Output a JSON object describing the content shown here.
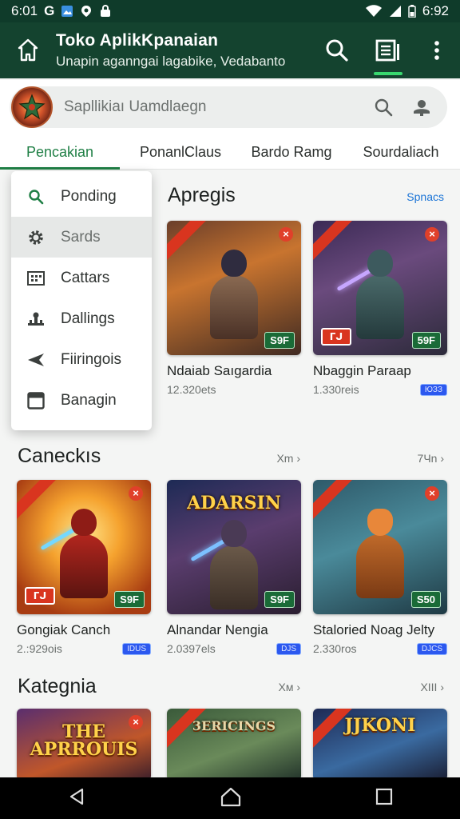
{
  "status": {
    "time_left": "6:01",
    "time_right": "6:92",
    "icons": [
      "g-icon",
      "photo-icon",
      "location-icon",
      "lock-icon",
      "wifi-icon",
      "signal-icon",
      "battery-icon"
    ]
  },
  "appbar": {
    "title": "Toko AplikKpanaian",
    "subtitle": "Unapin aganngai lagabike, Vedabanto",
    "icons": [
      "home-icon",
      "search-icon",
      "library-icon",
      "more-icon"
    ]
  },
  "search": {
    "placeholder": "Sapllikiaı Uamdlaegn"
  },
  "tabs": [
    "Pencakian",
    "PonanlClaus",
    "Bardo Ramg",
    "Sourdaliach"
  ],
  "menu": [
    {
      "label": "Ponding",
      "icon": "search-icon"
    },
    {
      "label": "Sards",
      "icon": "gear-icon"
    },
    {
      "label": "Cattars",
      "icon": "grid-icon"
    },
    {
      "label": "Dallings",
      "icon": "pawn-icon"
    },
    {
      "label": "Fiiringois",
      "icon": "plane-icon"
    },
    {
      "label": "Banagin",
      "icon": "window-icon"
    }
  ],
  "sections": [
    {
      "title": "Apregis",
      "link": "Spnacs",
      "cards": [
        {
          "name": "Ndaiab Saıgardia",
          "meta": "12.320ets",
          "price": "S9F",
          "pill": "",
          "badge": false
        },
        {
          "name": "Nbaggin Paraap",
          "meta": "1.330reis",
          "price": "59F",
          "pill": "ЮЗЗ",
          "badge": true
        }
      ]
    },
    {
      "title": "Caneckıs",
      "link_left": "Xm ›",
      "link": "7Чn ›",
      "cards": [
        {
          "name": "Gongiak Canch",
          "meta": "2.:929ois",
          "price": "S9F",
          "pill": "IDUS",
          "badge": true
        },
        {
          "name": "Alnandar Nengia",
          "meta": "2.0397els",
          "price": "S9F",
          "pill": "DJS",
          "banner": "ADARSIN"
        },
        {
          "name": "Staloried Noag Jelty",
          "meta": "2.330ros",
          "price": "S50",
          "pill": "DJCS"
        }
      ]
    },
    {
      "title": "Kategnia",
      "link_left": "Xм ›",
      "link": "XIII ›",
      "banners": [
        "THE APRROUIS",
        "3ERICINGS",
        "JJKONI"
      ]
    }
  ],
  "colors": {
    "appbar": "#14432f",
    "accent": "#1f7f45",
    "link": "#1b74d6",
    "price": "#1a6b37",
    "badge": "#d9351f"
  }
}
